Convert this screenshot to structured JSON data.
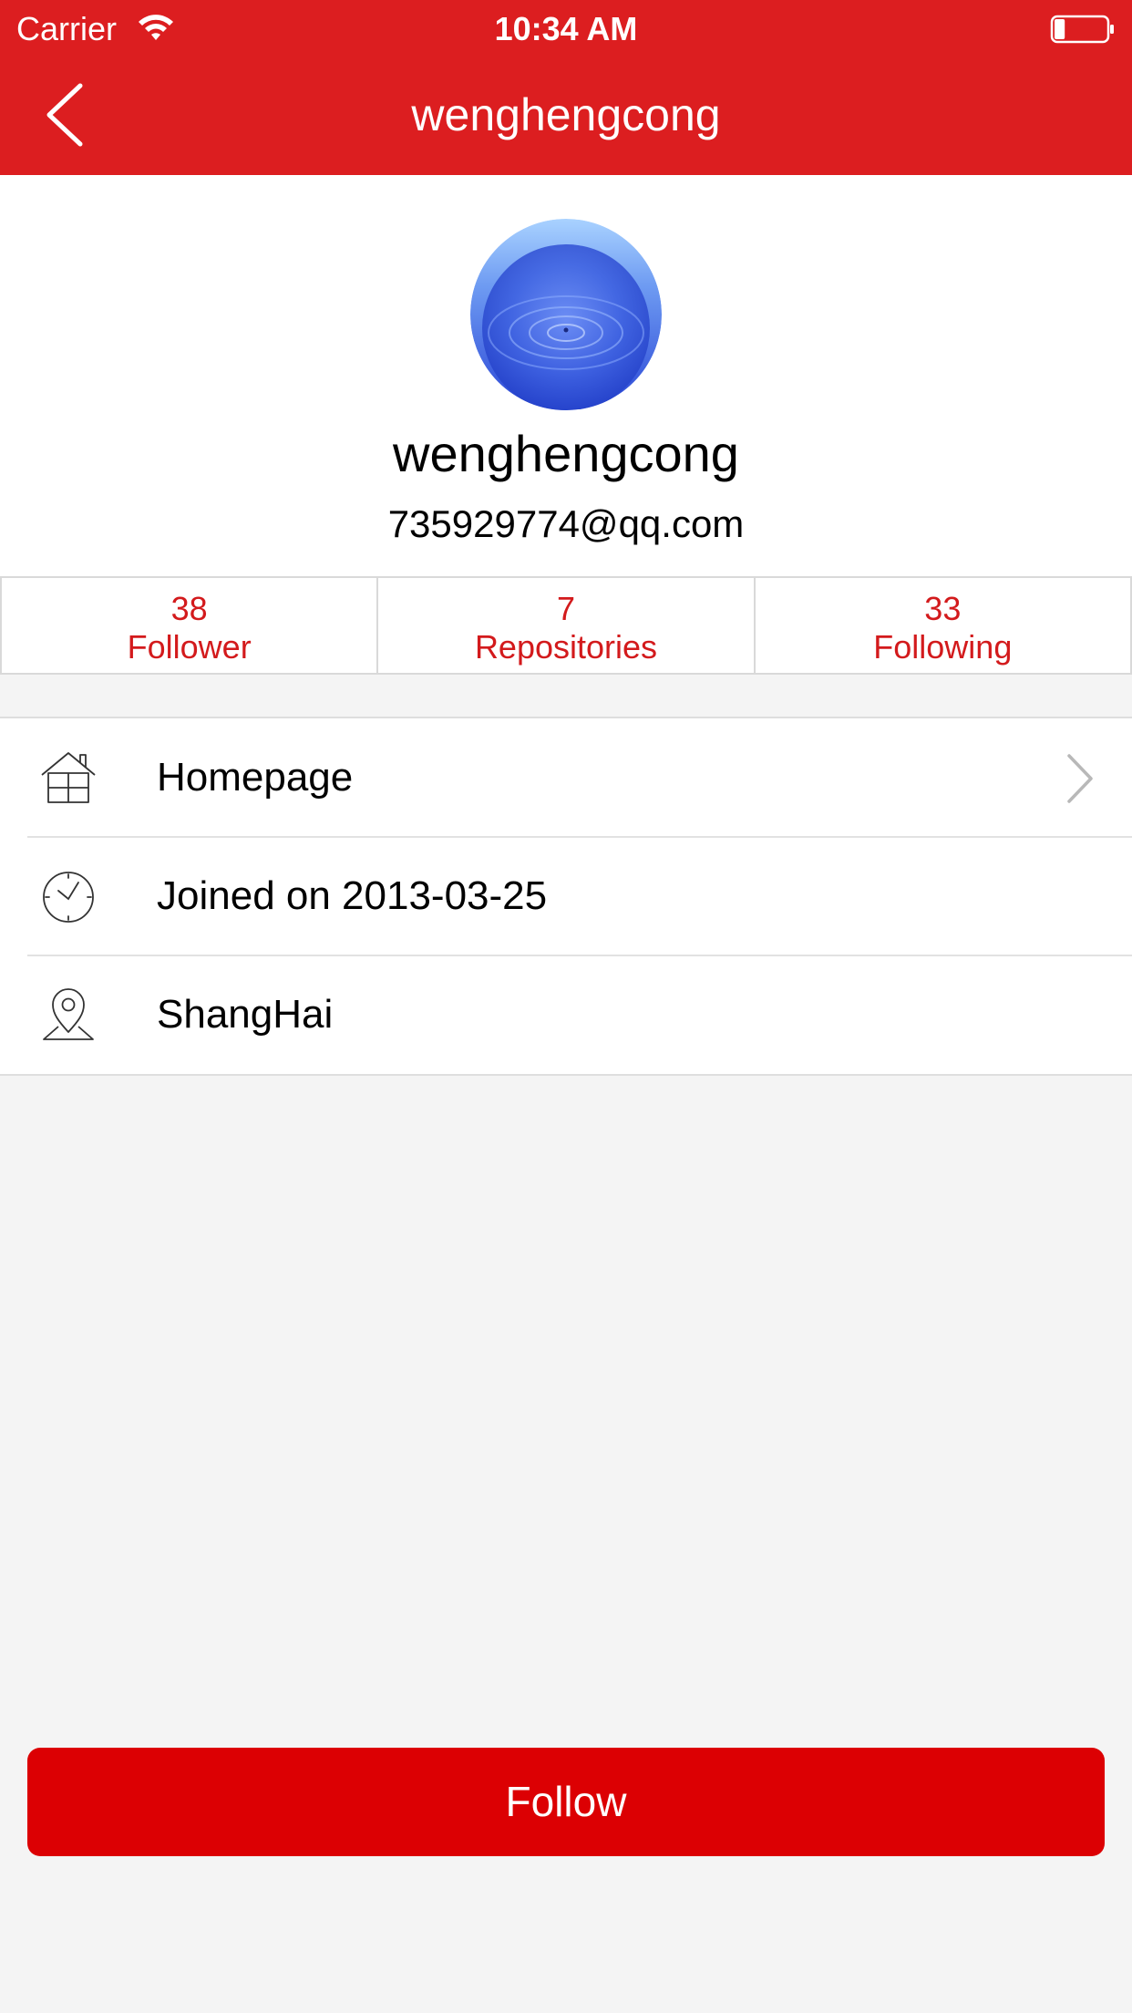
{
  "status_bar": {
    "carrier": "Carrier",
    "time": "10:34 AM",
    "wifi_icon": "wifi-icon",
    "battery_icon": "battery-icon",
    "battery_level": 0.2
  },
  "nav": {
    "title": "wenghengcong",
    "back_icon": "chevron-left-icon"
  },
  "profile": {
    "name": "wenghengcong",
    "email": "735929774@qq.com",
    "avatar_icon": "avatar-water-ripple-image"
  },
  "stats": [
    {
      "count": "38",
      "label": "Follower"
    },
    {
      "count": "7",
      "label": "Repositories"
    },
    {
      "count": "33",
      "label": "Following"
    }
  ],
  "info_rows": [
    {
      "label": "Homepage",
      "icon": "home-icon",
      "has_chevron": true
    },
    {
      "label": "Joined on 2013-03-25",
      "icon": "clock-icon",
      "has_chevron": false
    },
    {
      "label": "ShangHai",
      "icon": "location-pin-icon",
      "has_chevron": false
    }
  ],
  "actions": {
    "follow_label": "Follow"
  },
  "colors": {
    "brand_red": "#dc1e20",
    "stat_text": "#d31a1c",
    "follow_button": "#dc0003",
    "background": "#f4f4f4"
  }
}
